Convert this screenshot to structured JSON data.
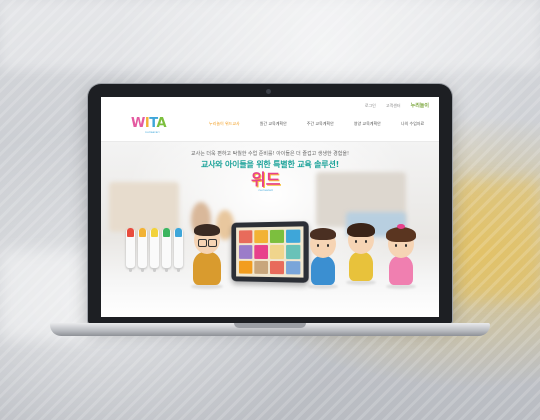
{
  "header": {
    "util_links": [
      "로그인",
      "고객센터"
    ],
    "util_logo": "누리놀이",
    "logo_text": "WITA",
    "logo_sub": "nurisarari",
    "nav": [
      {
        "label": "누리놀이 위드교사",
        "active": true
      },
      {
        "label": "원간 교육계획안",
        "active": false
      },
      {
        "label": "주간 교육계획안",
        "active": false
      },
      {
        "label": "영양 교육계획안",
        "active": false
      },
      {
        "label": "나의 수업자료",
        "active": false
      }
    ]
  },
  "hero": {
    "sub_copy": "교사는 더욱 편하고 탁월한 수업 준비를! 아이들은 더 즐겁고 생생한 경험을!",
    "main_copy": "교사와 아이들을 위한 특별한 교육 솔루션!",
    "product_name": "위드",
    "product_sub": "nurisarari"
  },
  "colors": {
    "accent": "#f29d1f",
    "teal": "#1da39a",
    "pink": "#e8418b",
    "pen_colors": [
      "#e84c3d",
      "#f2b234",
      "#f2d23b",
      "#3cb55f",
      "#3ea6d9"
    ]
  }
}
